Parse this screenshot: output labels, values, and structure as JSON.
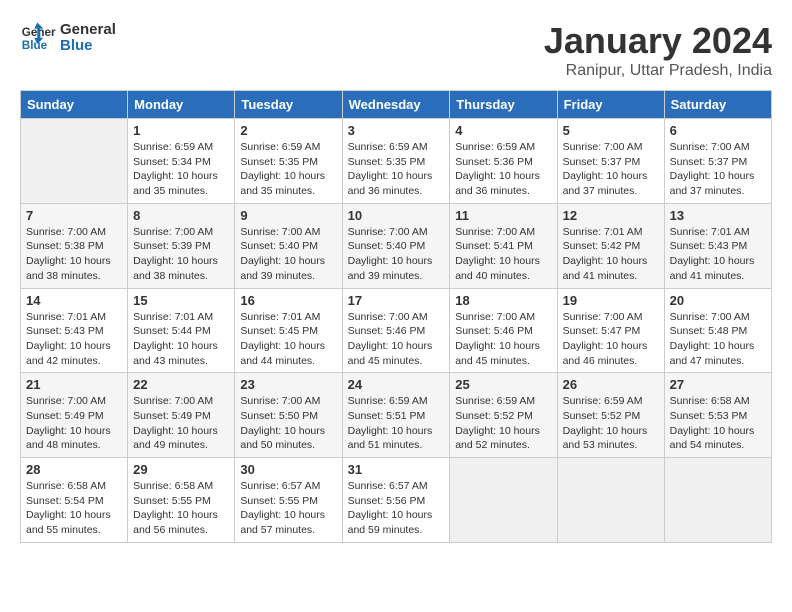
{
  "header": {
    "logo_line1": "General",
    "logo_line2": "Blue",
    "title": "January 2024",
    "subtitle": "Ranipur, Uttar Pradesh, India"
  },
  "columns": [
    "Sunday",
    "Monday",
    "Tuesday",
    "Wednesday",
    "Thursday",
    "Friday",
    "Saturday"
  ],
  "weeks": [
    [
      {
        "day": "",
        "sunrise": "",
        "sunset": "",
        "daylight": ""
      },
      {
        "day": "1",
        "sunrise": "Sunrise: 6:59 AM",
        "sunset": "Sunset: 5:34 PM",
        "daylight": "Daylight: 10 hours and 35 minutes."
      },
      {
        "day": "2",
        "sunrise": "Sunrise: 6:59 AM",
        "sunset": "Sunset: 5:35 PM",
        "daylight": "Daylight: 10 hours and 35 minutes."
      },
      {
        "day": "3",
        "sunrise": "Sunrise: 6:59 AM",
        "sunset": "Sunset: 5:35 PM",
        "daylight": "Daylight: 10 hours and 36 minutes."
      },
      {
        "day": "4",
        "sunrise": "Sunrise: 6:59 AM",
        "sunset": "Sunset: 5:36 PM",
        "daylight": "Daylight: 10 hours and 36 minutes."
      },
      {
        "day": "5",
        "sunrise": "Sunrise: 7:00 AM",
        "sunset": "Sunset: 5:37 PM",
        "daylight": "Daylight: 10 hours and 37 minutes."
      },
      {
        "day": "6",
        "sunrise": "Sunrise: 7:00 AM",
        "sunset": "Sunset: 5:37 PM",
        "daylight": "Daylight: 10 hours and 37 minutes."
      }
    ],
    [
      {
        "day": "7",
        "sunrise": "Sunrise: 7:00 AM",
        "sunset": "Sunset: 5:38 PM",
        "daylight": "Daylight: 10 hours and 38 minutes."
      },
      {
        "day": "8",
        "sunrise": "Sunrise: 7:00 AM",
        "sunset": "Sunset: 5:39 PM",
        "daylight": "Daylight: 10 hours and 38 minutes."
      },
      {
        "day": "9",
        "sunrise": "Sunrise: 7:00 AM",
        "sunset": "Sunset: 5:40 PM",
        "daylight": "Daylight: 10 hours and 39 minutes."
      },
      {
        "day": "10",
        "sunrise": "Sunrise: 7:00 AM",
        "sunset": "Sunset: 5:40 PM",
        "daylight": "Daylight: 10 hours and 39 minutes."
      },
      {
        "day": "11",
        "sunrise": "Sunrise: 7:00 AM",
        "sunset": "Sunset: 5:41 PM",
        "daylight": "Daylight: 10 hours and 40 minutes."
      },
      {
        "day": "12",
        "sunrise": "Sunrise: 7:01 AM",
        "sunset": "Sunset: 5:42 PM",
        "daylight": "Daylight: 10 hours and 41 minutes."
      },
      {
        "day": "13",
        "sunrise": "Sunrise: 7:01 AM",
        "sunset": "Sunset: 5:43 PM",
        "daylight": "Daylight: 10 hours and 41 minutes."
      }
    ],
    [
      {
        "day": "14",
        "sunrise": "Sunrise: 7:01 AM",
        "sunset": "Sunset: 5:43 PM",
        "daylight": "Daylight: 10 hours and 42 minutes."
      },
      {
        "day": "15",
        "sunrise": "Sunrise: 7:01 AM",
        "sunset": "Sunset: 5:44 PM",
        "daylight": "Daylight: 10 hours and 43 minutes."
      },
      {
        "day": "16",
        "sunrise": "Sunrise: 7:01 AM",
        "sunset": "Sunset: 5:45 PM",
        "daylight": "Daylight: 10 hours and 44 minutes."
      },
      {
        "day": "17",
        "sunrise": "Sunrise: 7:00 AM",
        "sunset": "Sunset: 5:46 PM",
        "daylight": "Daylight: 10 hours and 45 minutes."
      },
      {
        "day": "18",
        "sunrise": "Sunrise: 7:00 AM",
        "sunset": "Sunset: 5:46 PM",
        "daylight": "Daylight: 10 hours and 45 minutes."
      },
      {
        "day": "19",
        "sunrise": "Sunrise: 7:00 AM",
        "sunset": "Sunset: 5:47 PM",
        "daylight": "Daylight: 10 hours and 46 minutes."
      },
      {
        "day": "20",
        "sunrise": "Sunrise: 7:00 AM",
        "sunset": "Sunset: 5:48 PM",
        "daylight": "Daylight: 10 hours and 47 minutes."
      }
    ],
    [
      {
        "day": "21",
        "sunrise": "Sunrise: 7:00 AM",
        "sunset": "Sunset: 5:49 PM",
        "daylight": "Daylight: 10 hours and 48 minutes."
      },
      {
        "day": "22",
        "sunrise": "Sunrise: 7:00 AM",
        "sunset": "Sunset: 5:49 PM",
        "daylight": "Daylight: 10 hours and 49 minutes."
      },
      {
        "day": "23",
        "sunrise": "Sunrise: 7:00 AM",
        "sunset": "Sunset: 5:50 PM",
        "daylight": "Daylight: 10 hours and 50 minutes."
      },
      {
        "day": "24",
        "sunrise": "Sunrise: 6:59 AM",
        "sunset": "Sunset: 5:51 PM",
        "daylight": "Daylight: 10 hours and 51 minutes."
      },
      {
        "day": "25",
        "sunrise": "Sunrise: 6:59 AM",
        "sunset": "Sunset: 5:52 PM",
        "daylight": "Daylight: 10 hours and 52 minutes."
      },
      {
        "day": "26",
        "sunrise": "Sunrise: 6:59 AM",
        "sunset": "Sunset: 5:52 PM",
        "daylight": "Daylight: 10 hours and 53 minutes."
      },
      {
        "day": "27",
        "sunrise": "Sunrise: 6:58 AM",
        "sunset": "Sunset: 5:53 PM",
        "daylight": "Daylight: 10 hours and 54 minutes."
      }
    ],
    [
      {
        "day": "28",
        "sunrise": "Sunrise: 6:58 AM",
        "sunset": "Sunset: 5:54 PM",
        "daylight": "Daylight: 10 hours and 55 minutes."
      },
      {
        "day": "29",
        "sunrise": "Sunrise: 6:58 AM",
        "sunset": "Sunset: 5:55 PM",
        "daylight": "Daylight: 10 hours and 56 minutes."
      },
      {
        "day": "30",
        "sunrise": "Sunrise: 6:57 AM",
        "sunset": "Sunset: 5:55 PM",
        "daylight": "Daylight: 10 hours and 57 minutes."
      },
      {
        "day": "31",
        "sunrise": "Sunrise: 6:57 AM",
        "sunset": "Sunset: 5:56 PM",
        "daylight": "Daylight: 10 hours and 59 minutes."
      },
      {
        "day": "",
        "sunrise": "",
        "sunset": "",
        "daylight": ""
      },
      {
        "day": "",
        "sunrise": "",
        "sunset": "",
        "daylight": ""
      },
      {
        "day": "",
        "sunrise": "",
        "sunset": "",
        "daylight": ""
      }
    ]
  ]
}
